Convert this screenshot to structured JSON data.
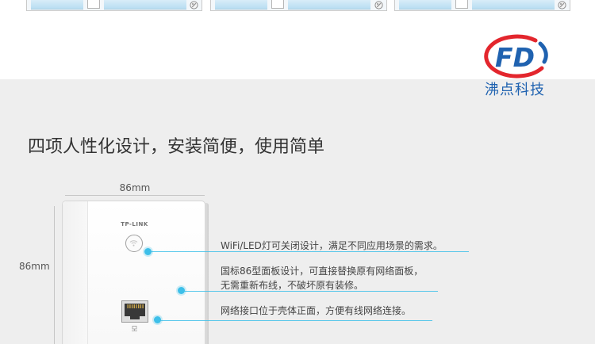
{
  "colors": {
    "page_background": "#ffffff",
    "band_background": "#eeeeee",
    "heading": "#333333",
    "body_text": "#444444",
    "callout": "#3dbfe9",
    "logo_red": "#e3262d",
    "logo_blue": "#1f62b0"
  },
  "thumbnails": [
    {
      "corner_icon": "circle-badge-icon"
    },
    {
      "corner_icon": "circle-badge-icon"
    },
    {
      "corner_icon": "circle-badge-icon"
    }
  ],
  "logo": {
    "lettering": "FD",
    "company_name": "沸点科技"
  },
  "heading": "四项人性化设计，安装简便，使用简单",
  "diagram": {
    "width_label": "86mm",
    "height_label": "86mm",
    "device": {
      "brand": "TP-LINK",
      "led_button_icon": "wifi-icon",
      "port_icon": "ethernet-port-icon",
      "port_marker_icon": "network-icon"
    },
    "features": [
      {
        "lines": [
          "WiFi/LED灯可关闭设计，满足不同应用场景的需求。"
        ]
      },
      {
        "lines": [
          "国标86型面板设计，可直接替换原有网络面板，",
          "无需重新布线，不破坏原有装修。"
        ]
      },
      {
        "lines": [
          "网络接口位于壳体正面，方便有线网络连接。"
        ]
      }
    ]
  }
}
